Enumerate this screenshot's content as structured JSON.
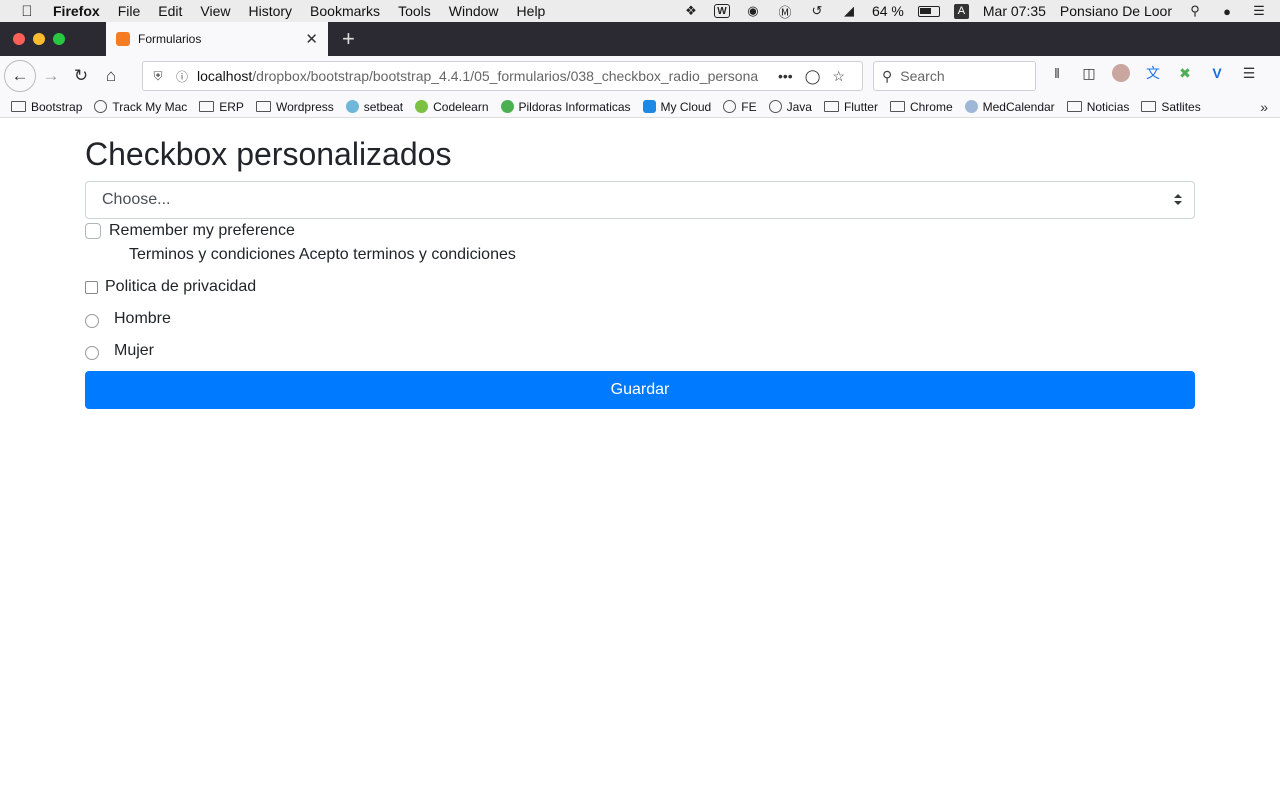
{
  "menubar": {
    "app": "Firefox",
    "items": [
      "File",
      "Edit",
      "View",
      "History",
      "Bookmarks",
      "Tools",
      "Window",
      "Help"
    ],
    "battery_text": "64 %",
    "battery_level": 0.64,
    "input_source": "A",
    "clock": "Mar 07:35",
    "user": "Ponsiano De Loor"
  },
  "tab": {
    "title": "Formularios"
  },
  "navbar": {
    "url_host": "localhost",
    "url_path": "/dropbox/bootstrap/bootstrap_4.4.1/05_formularios/038_checkbox_radio_persona",
    "search_placeholder": "Search"
  },
  "bookmarks": [
    {
      "label": "Bootstrap",
      "icon": "folder-icon"
    },
    {
      "label": "Track My Mac",
      "icon": "globe-icon"
    },
    {
      "label": "ERP",
      "icon": "folder-icon"
    },
    {
      "label": "Wordpress",
      "icon": "folder-icon"
    },
    {
      "label": "setbeat",
      "icon": "setbeat-icon"
    },
    {
      "label": "Codelearn",
      "icon": "codelearn-icon"
    },
    {
      "label": "Pildoras Informaticas",
      "icon": "pildoras-icon"
    },
    {
      "label": "My Cloud",
      "icon": "cloud-icon"
    },
    {
      "label": "FE",
      "icon": "globe-icon"
    },
    {
      "label": "Java",
      "icon": "globe-icon"
    },
    {
      "label": "Flutter",
      "icon": "folder-icon"
    },
    {
      "label": "Chrome",
      "icon": "folder-icon"
    },
    {
      "label": "MedCalendar",
      "icon": "medcalendar-icon"
    },
    {
      "label": "Noticias",
      "icon": "folder-icon"
    },
    {
      "label": "Satlites",
      "icon": "folder-icon"
    }
  ],
  "form": {
    "heading": "Checkbox personalizados",
    "select_value": "Choose...",
    "remember_label": "Remember my preference",
    "terms_text": "Terminos y condiciones Acepto terminos y condiciones",
    "privacy_label": "Politica de privacidad",
    "radio_1": "Hombre",
    "radio_2": "Mujer",
    "submit_label": "Guardar"
  },
  "colors": {
    "primary": "#007bff",
    "tabstrip": "#2b2a33",
    "text": "#212529"
  }
}
